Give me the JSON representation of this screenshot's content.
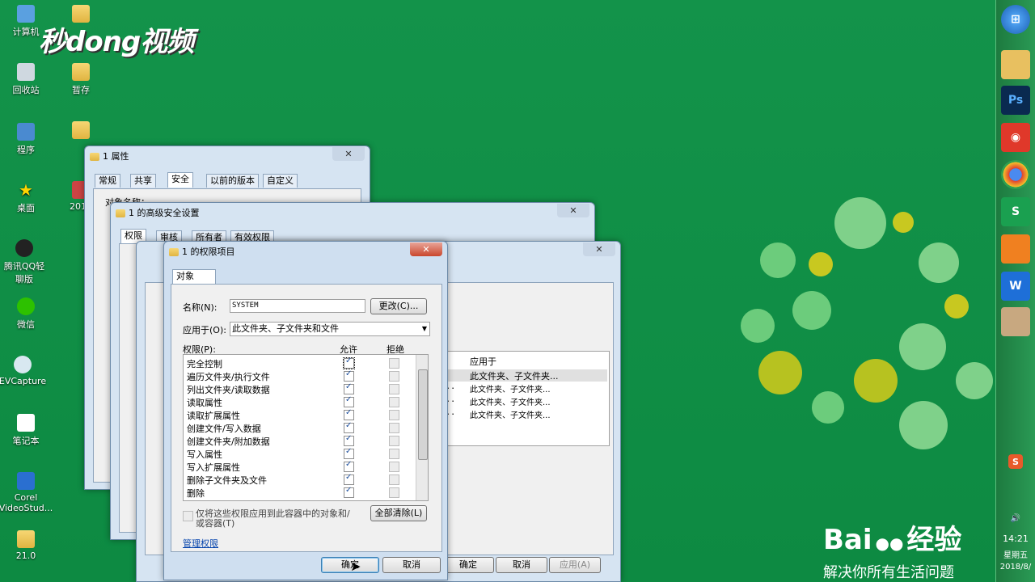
{
  "desktop": {
    "logo": "秒dong视频",
    "icons": [
      {
        "label": "计算机"
      },
      {
        "label": "回收站"
      },
      {
        "label": "暂存"
      },
      {
        "label": "程序"
      },
      {
        "label": "桌面"
      },
      {
        "label": "2018"
      },
      {
        "label": "腾讯QQ轻聊版"
      },
      {
        "label": "微信"
      },
      {
        "label": "EVCapture"
      },
      {
        "label": "笔记本"
      },
      {
        "label": "Corel VideoStud..."
      },
      {
        "label": "21.0"
      }
    ]
  },
  "watermark": {
    "brand": "Bai",
    "brand2": "经验",
    "slogan": "解决你所有生活问题"
  },
  "taskbar": {
    "time": "14:21",
    "weekday": "星期五",
    "date": "2018/8/"
  },
  "props_window": {
    "title": "1 属性",
    "tabs": [
      "常规",
      "共享",
      "安全",
      "以前的版本",
      "自定义"
    ],
    "object_name_label": "对象名称："
  },
  "adv_window": {
    "title": "1 的高级安全设置",
    "tabs": [
      "权限",
      "审核",
      "所有者",
      "有效权限"
    ]
  },
  "edit_window": {
    "list_header": "应用于",
    "entries": [
      {
        "name": "的>",
        "apply": "此文件夹、子文件夹..."
      },
      {
        "name": "dmin...",
        "apply": "此文件夹、子文件夹..."
      },
      {
        "name": "dmin...",
        "apply": "此文件夹、子文件夹..."
      },
      {
        "name": "dmin...",
        "apply": "此文件夹、子文件夹..."
      }
    ],
    "ok": "确定",
    "cancel": "取消",
    "apply": "应用(A)"
  },
  "perm_dialog": {
    "title": "1 的权限项目",
    "tab": "对象",
    "name_label": "名称(N):",
    "name_value": "SYSTEM",
    "change_button": "更改(C)...",
    "apply_to_label": "应用于(O):",
    "apply_to_value": "此文件夹、子文件夹和文件",
    "permissions_label": "权限(P):",
    "allow_header": "允许",
    "deny_header": "拒绝",
    "permissions": [
      {
        "name": "完全控制",
        "allow": true
      },
      {
        "name": "遍历文件夹/执行文件",
        "allow": true
      },
      {
        "name": "列出文件夹/读取数据",
        "allow": true
      },
      {
        "name": "读取属性",
        "allow": true
      },
      {
        "name": "读取扩展属性",
        "allow": true
      },
      {
        "name": "创建文件/写入数据",
        "allow": true
      },
      {
        "name": "创建文件夹/附加数据",
        "allow": true
      },
      {
        "name": "写入属性",
        "allow": true
      },
      {
        "name": "写入扩展属性",
        "allow": true
      },
      {
        "name": "删除子文件夹及文件",
        "allow": true
      },
      {
        "name": "删除",
        "allow": true
      }
    ],
    "only_apply_text": "仅将这些权限应用到此容器中的对象和/或容器(T)",
    "clear_all": "全部清除(L)",
    "manage_link": "管理权限",
    "ok": "确定",
    "cancel": "取消"
  }
}
